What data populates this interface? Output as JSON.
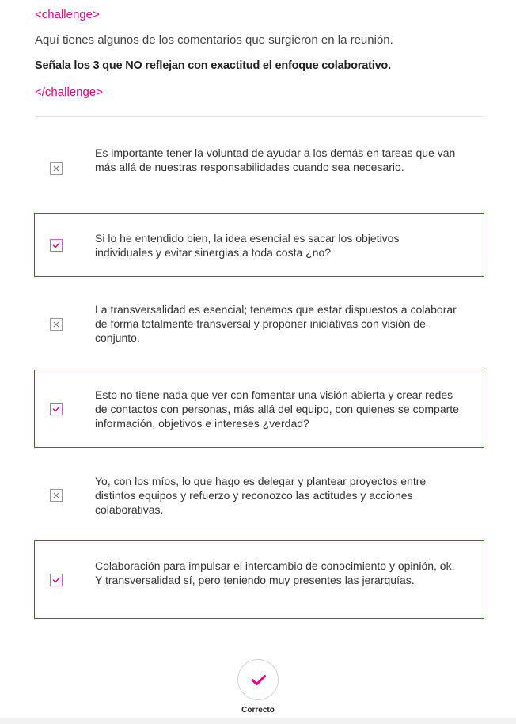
{
  "challenge": {
    "open_tag": "<challenge>",
    "close_tag": "</challenge>",
    "intro": "Aquí tienes algunos de los comentarios que surgieron en la reunión.",
    "instruction": "Señala los 3 que NO reflejan con exactitud el enfoque colaborativo."
  },
  "options": [
    {
      "text": "Es importante tener la voluntad de ayudar a los demás en tareas que van más allá de nuestras responsabilidades cuando sea necesario.",
      "selected": false,
      "icon": "x-icon"
    },
    {
      "text": "Si lo he entendido bien, la idea esencial es sacar los objetivos individuales y evitar sinergias a toda costa ¿no?",
      "selected": true,
      "icon": "check-icon"
    },
    {
      "text": "La transversalidad es esencial; tenemos que estar dispuestos a colaborar de forma totalmente transversal y proponer iniciativas con visión de conjunto.",
      "selected": false,
      "icon": "x-icon"
    },
    {
      "text": "Esto no tiene nada que ver con fomentar una visión abierta y crear redes de contactos con personas, más allá del equipo, con quienes se comparte información, objetivos e intereses ¿verdad?",
      "selected": true,
      "icon": "check-icon"
    },
    {
      "text": "Yo, con los míos, lo que hago es delegar y plantear proyectos entre distintos equipos y refuerzo y reconozco las actitudes y acciones colaborativas.",
      "selected": false,
      "icon": "x-icon"
    },
    {
      "text": "Colaboración para impulsar el intercambio de conocimiento y opinión, ok. Y transversalidad sí, pero teniendo muy presentes las jerarquías.",
      "selected": true,
      "icon": "check-icon"
    }
  ],
  "submit": {
    "label": "Correcto",
    "icon": "check-icon"
  },
  "colors": {
    "accent": "#e6007e",
    "selected_border": "#9b2a9e"
  }
}
